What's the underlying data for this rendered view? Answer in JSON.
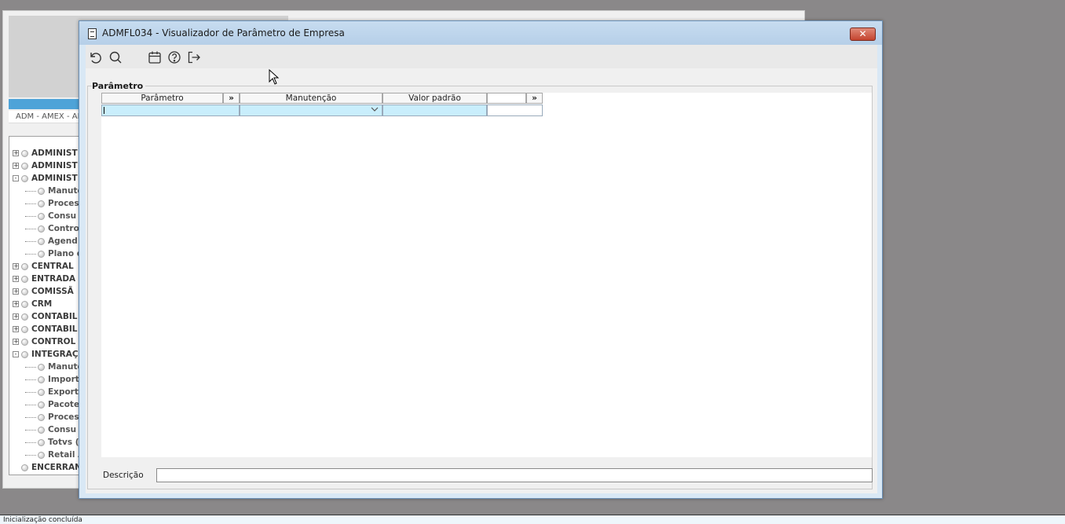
{
  "background_app": {
    "breadcrumb": "ADM - AMEX - AM",
    "tree_items": [
      {
        "label": "ADMINIST",
        "level": 0,
        "toggle": "+"
      },
      {
        "label": "ADMINIST",
        "level": 0,
        "toggle": "+"
      },
      {
        "label": "ADMINIST",
        "level": 0,
        "toggle": "-"
      },
      {
        "label": "Manute",
        "level": 1,
        "toggle": ""
      },
      {
        "label": "Proces",
        "level": 1,
        "toggle": ""
      },
      {
        "label": "Consu",
        "level": 1,
        "toggle": ""
      },
      {
        "label": "Contro",
        "level": 1,
        "toggle": ""
      },
      {
        "label": "Agend",
        "level": 1,
        "toggle": ""
      },
      {
        "label": "Plano d",
        "level": 1,
        "toggle": ""
      },
      {
        "label": "CENTRAL",
        "level": 0,
        "toggle": "+"
      },
      {
        "label": "ENTRADA",
        "level": 0,
        "toggle": "+"
      },
      {
        "label": "COMISSÃ",
        "level": 0,
        "toggle": "+"
      },
      {
        "label": "CRM",
        "level": 0,
        "toggle": "+"
      },
      {
        "label": "CONTABIL",
        "level": 0,
        "toggle": "+"
      },
      {
        "label": "CONTABIL",
        "level": 0,
        "toggle": "+"
      },
      {
        "label": "CONTROL",
        "level": 0,
        "toggle": "+"
      },
      {
        "label": "INTEGRAÇ",
        "level": 0,
        "toggle": "-"
      },
      {
        "label": "Manute",
        "level": 1,
        "toggle": ""
      },
      {
        "label": "Import",
        "level": 1,
        "toggle": ""
      },
      {
        "label": "Exporta",
        "level": 1,
        "toggle": ""
      },
      {
        "label": "Pacote",
        "level": 1,
        "toggle": ""
      },
      {
        "label": "Proces",
        "level": 1,
        "toggle": ""
      },
      {
        "label": "Consu",
        "level": 1,
        "toggle": ""
      },
      {
        "label": "Totvs (",
        "level": 1,
        "toggle": ""
      },
      {
        "label": "Retail A",
        "level": 1,
        "toggle": ""
      },
      {
        "label": "ENCERRAN",
        "level": 0,
        "toggle": ""
      }
    ],
    "status_text": "Inicialização concluída"
  },
  "dialog": {
    "title": "ADMFL034 - Visualizador de Parâmetro de Empresa",
    "close_label": "✕",
    "toolbar": {
      "buttons": [
        {
          "icon": "undo-icon"
        },
        {
          "icon": "search-icon"
        },
        {
          "icon": "calendar-icon"
        },
        {
          "icon": "help-icon"
        },
        {
          "icon": "exit-icon"
        }
      ]
    },
    "group_title": "Parâmetro",
    "grid": {
      "headers": {
        "param": "Parâmetro",
        "param_more": "»",
        "manut": "Manutenção",
        "valor": "Valor padrão",
        "more": "»"
      },
      "row": {
        "param": "",
        "manut": "",
        "valor": "",
        "extra": ""
      }
    },
    "description_label": "Descrição",
    "description_value": ""
  },
  "colors": {
    "accent_blue": "#4ea3d8",
    "selected_cell": "#c9eefc",
    "close_red": "#c4442f"
  }
}
